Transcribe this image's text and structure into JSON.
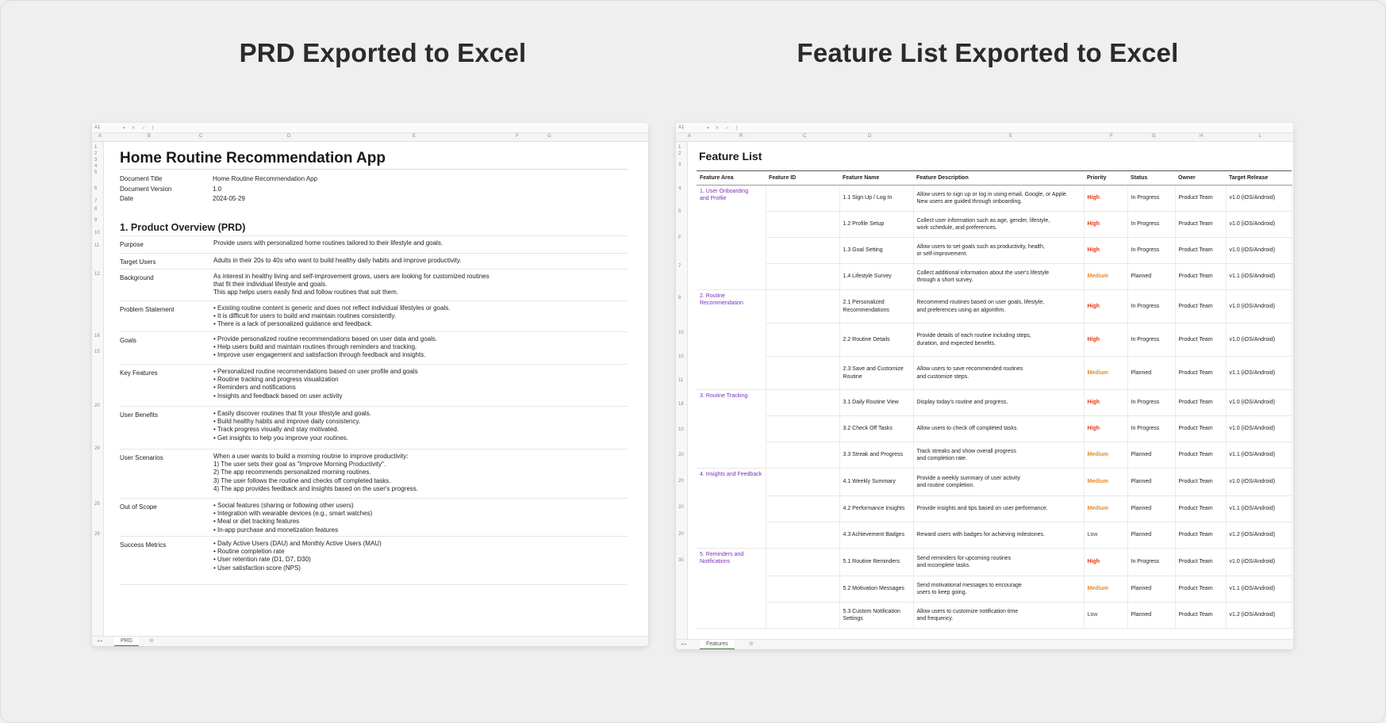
{
  "headings": {
    "left": "PRD Exported to Excel",
    "right": "Feature List Exported to Excel"
  },
  "prd_sheet": {
    "cell_ref": "A1",
    "columns": [
      "A",
      "B",
      "C",
      "D",
      "E",
      "F",
      "G"
    ],
    "row_numbers": [
      "1",
      "2",
      "3",
      "4",
      "5",
      "6",
      "7",
      "8",
      "9",
      "10",
      "11",
      "12",
      "16",
      "15",
      "20",
      "29",
      "25",
      "29"
    ],
    "title": "Home Routine Recommendation App",
    "meta": [
      {
        "key": "Document Title",
        "value": "Home Routine Recommendation App"
      },
      {
        "key": "Document Version",
        "value": "1.0"
      },
      {
        "key": "Date",
        "value": "2024-05-29"
      }
    ],
    "section_title": "1. Product Overview (PRD)",
    "rows": [
      {
        "key": "Purpose",
        "lines": [
          "Provide users with personalized home routines tailored to their lifestyle and goals."
        ]
      },
      {
        "key": "Target Users",
        "lines": [
          "Adults in their 20s to 40s who want to build healthy daily habits and improve productivity."
        ]
      },
      {
        "key": "Background",
        "lines": [
          "As interest in healthy living and self-improvement grows, users are looking for customized routines",
          "that fit their individual lifestyle and goals.",
          "This app helps users easily find and follow routines that suit them."
        ]
      },
      {
        "key": "Problem Statement",
        "lines": [
          "• Existing routine content is generic and does not reflect individual lifestyles or goals.",
          "• It is difficult for users to build and maintain routines consistently.",
          "• There is a lack of personalized guidance and feedback."
        ]
      },
      {
        "key": "Goals",
        "lines": [
          "• Provide personalized routine recommendations based on user data and goals.",
          "• Help users build and maintain routines through reminders and tracking.",
          "• Improve user engagement and satisfaction through feedback and insights."
        ]
      },
      {
        "key": "Key Features",
        "lines": [
          "• Personalized routine recommendations based on user profile and goals",
          "• Routine tracking and progress visualization",
          "• Reminders and notifications",
          "• Insights and feedback based on user activity"
        ]
      },
      {
        "key": "User Benefits",
        "lines": [
          "• Easily discover routines that fit your lifestyle and goals.",
          "• Build healthy habits and improve daily consistency.",
          "• Track progress visually and stay motivated.",
          "• Get insights to help you improve your routines."
        ]
      },
      {
        "key": "User Scenarios",
        "lines": [
          "When a user wants to build a morning routine to improve productivity:",
          "1) The user sets their goal as \"Improve Morning Productivity\".",
          "2) The app recommends personalized morning routines.",
          "3) The user follows the routine and checks off completed tasks.",
          "4) The app provides feedback and insights based on the user's progress."
        ]
      },
      {
        "key": "Out of Scope",
        "lines": [
          "• Social features (sharing or following other users)",
          "• Integration with wearable devices (e.g., smart watches)",
          "• Meal or diet tracking features",
          "• In-app purchase and monetization features"
        ]
      },
      {
        "key": "Success Metrics",
        "lines": [
          "• Daily Active Users (DAU) and Monthly Active Users (MAU)",
          "• Routine completion rate",
          "• User retention rate (D1, D7, D30)",
          "• User satisfaction score (NPS)"
        ]
      }
    ],
    "tab": "PRD"
  },
  "feature_sheet": {
    "cell_ref": "A1",
    "columns": [
      "A",
      "R",
      "C",
      "D",
      "E",
      "F",
      "G",
      "H",
      "L"
    ],
    "row_numbers": [
      "1",
      "2",
      "3",
      "4",
      "5",
      "F",
      "7",
      "8",
      "10",
      "10",
      "11",
      "18",
      "10",
      "20",
      "20",
      "20",
      "20",
      "30"
    ],
    "title": "Feature List",
    "headers": [
      "Feature Area",
      "Feature ID",
      "Feature Name",
      "Feature Description",
      "Priority",
      "Status",
      "Owner",
      "Target Release"
    ],
    "groups": [
      {
        "area": [
          "1. User Onboarding",
          "and Profile"
        ],
        "rows": [
          {
            "name": [
              "1.1 Sign Up / Log In"
            ],
            "desc": [
              "Allow users to sign up or log in using email, Google, or Apple.",
              "New users are guided through onboarding."
            ],
            "priority": "High",
            "status": "In Progress",
            "owner": "Product Team",
            "release": "v1.0 (iOS/Android)"
          },
          {
            "name": [
              "1.2 Profile Setup"
            ],
            "desc": [
              "Collect user information such as age, gender, lifestyle,",
              "work schedule, and preferences."
            ],
            "priority": "High",
            "status": "In Progress",
            "owner": "Product Team",
            "release": "v1.0 (iOS/Android)"
          },
          {
            "name": [
              "1.3 Goal Setting"
            ],
            "desc": [
              "Allow users to set goals such as productivity, health,",
              "or self-improvement."
            ],
            "priority": "High",
            "status": "In Progress",
            "owner": "Product Team",
            "release": "v1.0 (iOS/Android)"
          },
          {
            "name": [
              "1.4 Lifestyle Survey"
            ],
            "desc": [
              "Collect additional information about the user's lifestyle",
              "through a short survey."
            ],
            "priority": "Medium",
            "status": "Planned",
            "owner": "Product Team",
            "release": "v1.1 (iOS/Android)"
          }
        ]
      },
      {
        "area": [
          "2. Routine",
          "Recommendation"
        ],
        "rows": [
          {
            "name": [
              "2.1 Personalized",
              "Recommendations"
            ],
            "desc": [
              "Recommend routines based on user goals, lifestyle,",
              "and preferences using an algorithm."
            ],
            "priority": "High",
            "status": "In Progress",
            "owner": "Product Team",
            "release": "v1.0 (iOS/Android)"
          },
          {
            "name": [
              "2.2 Routine Details"
            ],
            "desc": [
              "Provide details of each routine including steps,",
              "duration, and expected benefits."
            ],
            "priority": "High",
            "status": "In Progress",
            "owner": "Product Team",
            "release": "v1.0 (iOS/Android)"
          },
          {
            "name": [
              "2.3 Save and Customize",
              "Routine"
            ],
            "desc": [
              "Allow users to save recommended routines",
              "and customize steps."
            ],
            "priority": "Medium",
            "status": "Planned",
            "owner": "Product Team",
            "release": "v1.1 (iOS/Android)"
          }
        ]
      },
      {
        "area": [
          "3. Routine Tracking"
        ],
        "rows": [
          {
            "name": [
              "3.1 Daily Routine View"
            ],
            "desc": [
              "Display today's routine and progress."
            ],
            "priority": "High",
            "status": "In Progress",
            "owner": "Product Team",
            "release": "v1.0 (iOS/Android)"
          },
          {
            "name": [
              "3.2 Check Off Tasks"
            ],
            "desc": [
              "Allow users to check off completed tasks."
            ],
            "priority": "High",
            "status": "In Progress",
            "owner": "Product Team",
            "release": "v1.0 (iOS/Android)"
          },
          {
            "name": [
              "3.3 Streak and Progress"
            ],
            "desc": [
              "Track streaks and show overall progress",
              "and completion rate."
            ],
            "priority": "Medium",
            "status": "Planned",
            "owner": "Product Team",
            "release": "v1.1 (iOS/Android)"
          }
        ]
      },
      {
        "area": [
          "4. Insights and Feedback"
        ],
        "rows": [
          {
            "name": [
              "4.1 Weekly Summary"
            ],
            "desc": [
              "Provide a weekly summary of user activity",
              "and routine completion."
            ],
            "priority": "Medium",
            "status": "Planned",
            "owner": "Product Team",
            "release": "v1.0 (iOS/Android)"
          },
          {
            "name": [
              "4.2 Performance Insights"
            ],
            "desc": [
              "Provide insights and tips based on user performance."
            ],
            "priority": "Medium",
            "status": "Planned",
            "owner": "Product Team",
            "release": "v1.1 (iOS/Android)"
          },
          {
            "name": [
              "4.3 Achievement Badges"
            ],
            "desc": [
              "Reward users with badges for achieving milestones."
            ],
            "priority": "Low",
            "status": "Planned",
            "owner": "Product Team",
            "release": "v1.2 (iOS/Android)"
          }
        ]
      },
      {
        "area": [
          "5. Reminders and",
          "Notifications"
        ],
        "rows": [
          {
            "name": [
              "5.1 Routine Reminders"
            ],
            "desc": [
              "Send reminders for upcoming routines",
              "and incomplete tasks."
            ],
            "priority": "High",
            "status": "In Progress",
            "owner": "Product Team",
            "release": "v1.0 (iOS/Android)"
          },
          {
            "name": [
              "5.2 Motivation Messages"
            ],
            "desc": [
              "Send motivational messages to encourage",
              "users to keep going."
            ],
            "priority": "Medium",
            "status": "Planned",
            "owner": "Product Team",
            "release": "v1.1 (iOS/Android)"
          },
          {
            "name": [
              "5.3 Custom Notification",
              "Settings"
            ],
            "desc": [
              "Allow users to customize notification time",
              "and frequency."
            ],
            "priority": "Low",
            "status": "Planned",
            "owner": "Product Team",
            "release": "v1.2 (iOS/Android)"
          }
        ]
      }
    ],
    "tab": "Features"
  }
}
